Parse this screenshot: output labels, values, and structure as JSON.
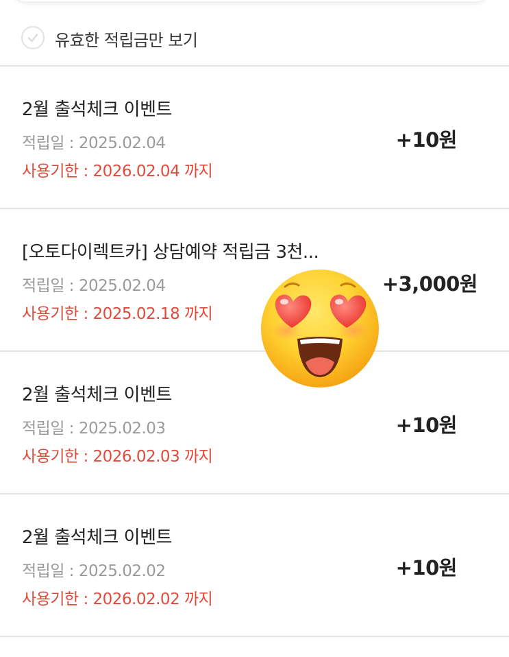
{
  "filter": {
    "checkbox_state": "unchecked",
    "label": "유효한 적립금만 보기"
  },
  "items": [
    {
      "title": "2월 출석체크 이벤트",
      "date": "적립일 : 2025.02.04",
      "expiry": "사용기한 : 2026.02.04 까지",
      "amount": "+10원"
    },
    {
      "title": "[오토다이렉트카] 상담예약 적립금 3천...",
      "date": "적립일 : 2025.02.04",
      "expiry": "사용기한 : 2025.02.18 까지",
      "amount": "+3,000원"
    },
    {
      "title": "2월 출석체크 이벤트",
      "date": "적립일 : 2025.02.03",
      "expiry": "사용기한 : 2026.02.03 까지",
      "amount": "+10원"
    },
    {
      "title": "2월 출석체크 이벤트",
      "date": "적립일 : 2025.02.02",
      "expiry": "사용기한 : 2026.02.02 까지",
      "amount": "+10원"
    }
  ],
  "colors": {
    "expiry_red": "#e04a3b",
    "muted_gray": "#9a9a9a",
    "text_dark": "#222222",
    "divider": "#e3e3e3"
  },
  "icons": {
    "checkbox": "check-circle-icon",
    "sticker": "heart-eyes-emoji"
  }
}
